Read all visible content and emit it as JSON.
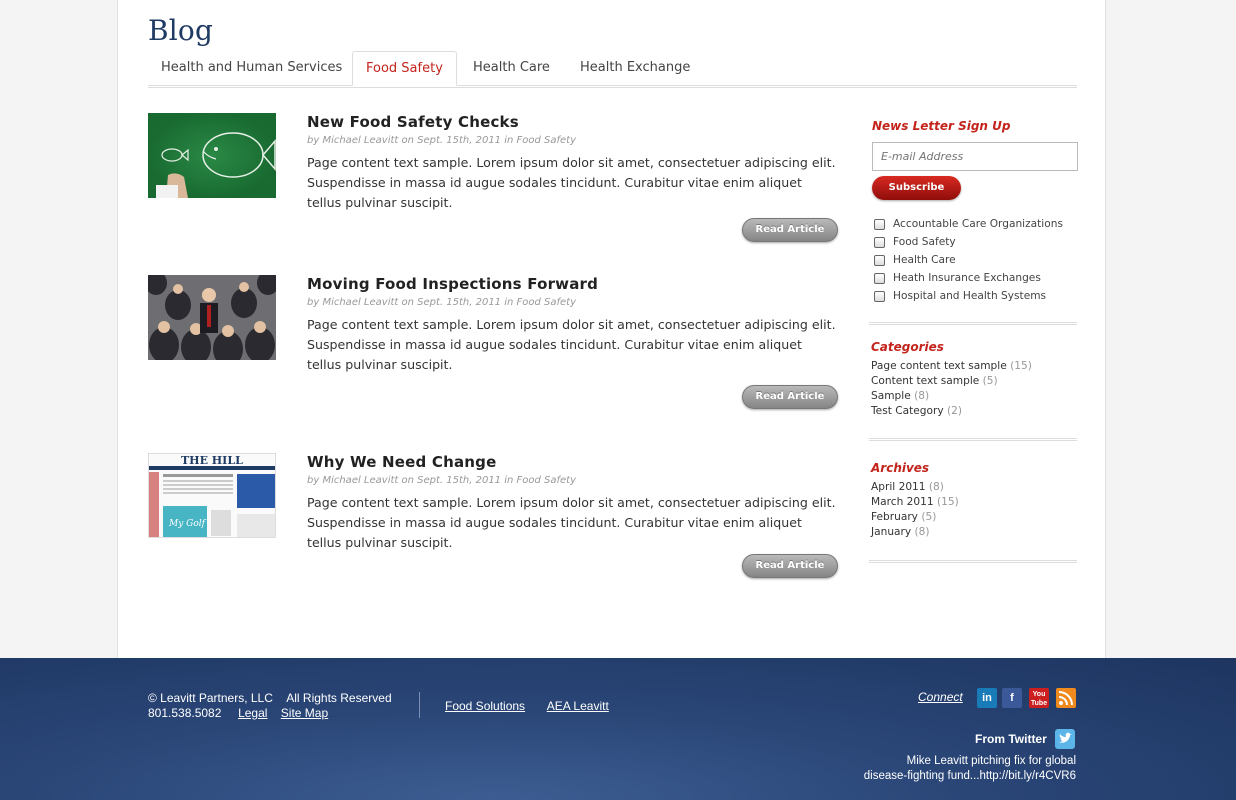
{
  "blog_title": "Blog",
  "tabs": [
    {
      "label": "Health and Human Services",
      "active": false
    },
    {
      "label": "Food Safety",
      "active": true
    },
    {
      "label": "Health Care",
      "active": false
    },
    {
      "label": "Health Exchange",
      "active": false
    }
  ],
  "articles": [
    {
      "title": "New Food Safety Checks",
      "meta": "by Michael Leavitt on Sept. 15th, 2011 in Food Safety",
      "text": "Page content text sample. Lorem ipsum dolor sit amet, consectetuer  adipiscing elit. Suspendisse in massa id augue sodales tincidunt. Curabitur vitae enim aliquet tellus pulvinar suscipit.",
      "button": "Read Article"
    },
    {
      "title": "Moving Food Inspections Forward",
      "meta": "by Michael Leavitt on Sept. 15th, 2011 in Food Safety",
      "text": "Page content text sample. Lorem ipsum dolor sit amet, consectetuer  adipiscing elit. Suspendisse in massa id augue sodales tincidunt. Curabitur vitae enim aliquet tellus pulvinar suscipit.",
      "button": "Read Article"
    },
    {
      "title": "Why We Need Change",
      "meta": "by Michael Leavitt on Sept. 15th, 2011 in Food Safety",
      "text": "Page content text sample. Lorem ipsum dolor sit amet, consectetuer  adipiscing elit. Suspendisse in massa id augue sodales tincidunt. Curabitur vitae enim aliquet tellus pulvinar suscipit.",
      "button": "Read Article",
      "thumb_logo": "THE HILL"
    }
  ],
  "sidebar": {
    "newsletter_heading": "News Letter Sign Up",
    "email_placeholder": "E-mail Address",
    "subscribe_label": "Subscribe",
    "checkboxes": [
      "Accountable Care Organizations",
      "Food Safety",
      "Health Care",
      "Heath Insurance Exchanges",
      "Hospital and Health Systems"
    ],
    "categories_heading": "Categories",
    "categories": [
      {
        "label": "Page content text sample",
        "count": "(15)"
      },
      {
        "label": "Content text sample",
        "count": "(5)"
      },
      {
        "label": "Sample",
        "count": "(8)"
      },
      {
        "label": "Test Category",
        "count": "(2)"
      }
    ],
    "archives_heading": "Archives",
    "archives": [
      {
        "label": "April 2011",
        "count": "(8)"
      },
      {
        "label": "March 2011",
        "count": "(15)"
      },
      {
        "label": "February",
        "count": "(5)"
      },
      {
        "label": "January",
        "count": "(8)"
      }
    ]
  },
  "footer": {
    "copyright": "© Leavitt Partners, LLC",
    "rights": "All Rights Reserved",
    "phone": "801.538.5082",
    "legal": "Legal",
    "sitemap": "Site Map",
    "link1": "Food Solutions",
    "link2": "AEA Leavitt",
    "connect": "Connect",
    "social": [
      "linkedin-icon",
      "facebook-icon",
      "youtube-icon",
      "rss-icon"
    ],
    "from_twitter": "From Twitter",
    "tweet_line1": "Mike Leavitt pitching fix for global",
    "tweet_line2": "disease-fighting fund...http://bit.ly/r4CVR6"
  }
}
